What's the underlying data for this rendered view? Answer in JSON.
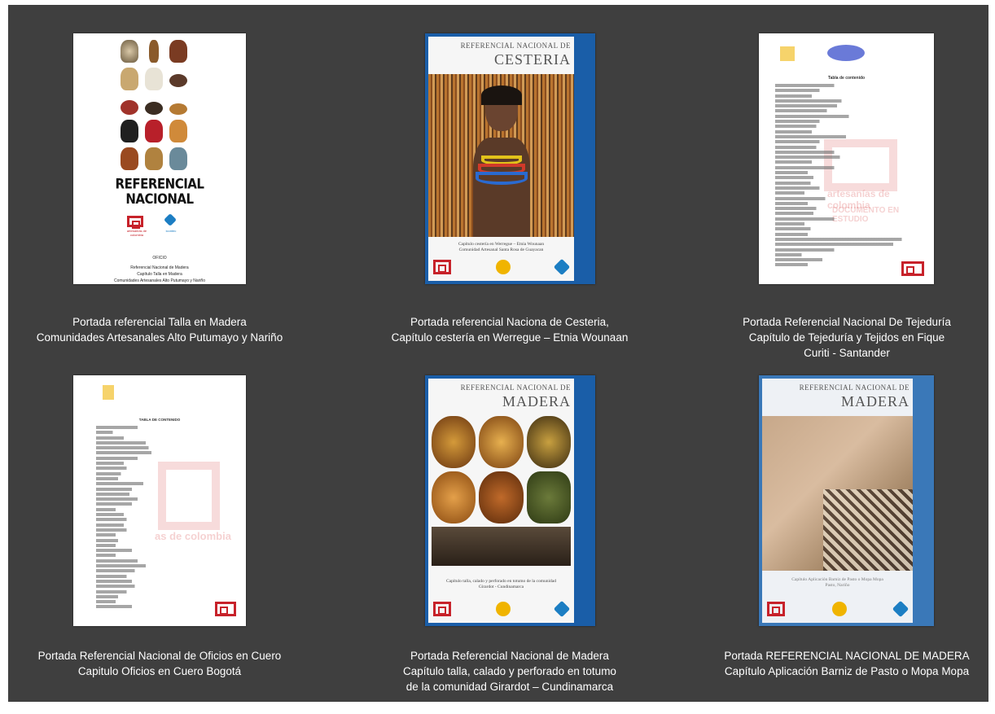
{
  "items": [
    {
      "cover": {
        "title_line1": "REFERENCIAL",
        "title_line2": "NACIONAL",
        "logo_text": "artesanías de colombia",
        "logo2_text": "icontec",
        "footer_1": "OFICIO",
        "footer_2": "Referencial Nacional de Madera",
        "footer_3": "Capítulo Talla en Madera",
        "footer_4": "Comunidades Artesanales Alto Putumayo y Nariño"
      },
      "caption": [
        "Portada referencial Talla en Madera",
        "Comunidades Artesanales Alto Putumayo y Nariño"
      ]
    },
    {
      "cover": {
        "series": "REFERENCIAL NACIONAL DE",
        "craft": "CESTERIA",
        "subtitle_1": "Capítulo cestería en Werregue – Etnia Wounaan",
        "subtitle_2": "Comunidad Artesanal Santa Rosa de Guayacan",
        "logo_text": "icontec"
      },
      "caption": [
        "Portada referencial Naciona de Cesteria,",
        "Capítulo cestería en Werregue – Etnia Wounaan"
      ]
    },
    {
      "cover": {
        "header": "Tabla de contenido",
        "watermark": "artesanías de colombia",
        "stamp": "DOCUMENTO EN ESTUDIO"
      },
      "caption": [
        "Portada Referencial Nacional De Tejeduría",
        "Capítulo  de Tejeduría y Tejidos en Fique",
        "Curiti - Santander"
      ]
    },
    {
      "cover": {
        "header": "TABLA DE CONTENIDO",
        "watermark": "as de colombia"
      },
      "caption": [
        "Portada Referencial Nacional de Oficios en Cuero",
        "Capitulo Oficios en Cuero Bogotá"
      ]
    },
    {
      "cover": {
        "series": "REFERENCIAL NACIONAL DE",
        "craft": "MADERA",
        "subtitle_1": "Capítulo talla, calado y perforado en totumo de la comunidad",
        "subtitle_2": "Girardot - Cundinamarca",
        "logo_text": "icontec"
      },
      "caption": [
        "Portada Referencial Nacional de Madera",
        "Capítulo talla, calado y perforado en totumo",
        "de la comunidad Girardot – Cundinamarca"
      ]
    },
    {
      "cover": {
        "series": "REFERENCIAL NACIONAL DE",
        "craft": "MADERA",
        "subtitle_1": "Capítulo Aplicación Barniz de Pasto o Mopa Mopa",
        "subtitle_2": "Pasto, Nariño"
      },
      "caption": [
        "Portada REFERENCIAL NACIONAL DE MADERA",
        "Capítulo Aplicación Barniz de Pasto o Mopa Mopa"
      ]
    }
  ],
  "colors": {
    "background": "#3f3f3f",
    "caption_text": "#ffffff",
    "band_blue": "#1a5ea8",
    "brand_red": "#c7222a"
  }
}
